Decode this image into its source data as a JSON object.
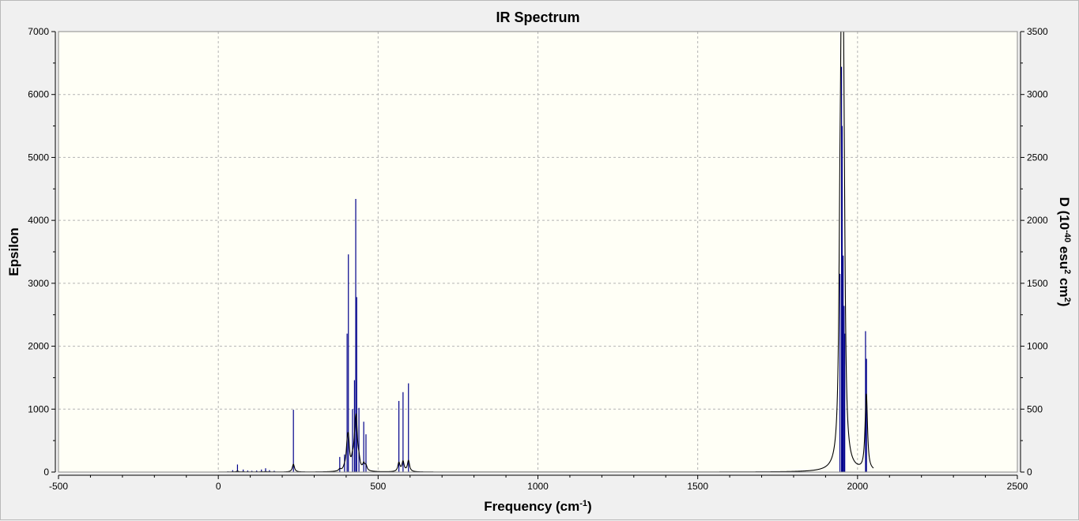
{
  "colors": {
    "plot_background": "#fffff6",
    "window_background": "#f0f0f0",
    "grid": "#b4b4b4",
    "stick_color": "#00008b",
    "curve_color": "#000000"
  },
  "chart_data": {
    "type": "line",
    "title": "IR Spectrum",
    "xlabel": {
      "text": "Frequency (cm",
      "superscript": "-1",
      "suffix": ")"
    },
    "ylabel_left": "Epsilon",
    "ylabel_right": {
      "parts": [
        {
          "text": "D (10"
        },
        {
          "text": "-40",
          "sup": true
        },
        {
          "text": " esu"
        },
        {
          "text": "2",
          "sup": true
        },
        {
          "text": " cm"
        },
        {
          "text": "2",
          "sup": true
        },
        {
          "text": ")"
        }
      ]
    },
    "xlim": [
      -500,
      2500
    ],
    "ylim_left": [
      0,
      7000
    ],
    "ylim_right": [
      0,
      3500
    ],
    "x_ticks": [
      "-500",
      "0",
      "500",
      "1000",
      "1500",
      "2000",
      "2500"
    ],
    "y_ticks_left": [
      "0",
      "1000",
      "2000",
      "3000",
      "4000",
      "5000",
      "6000",
      "7000"
    ],
    "y_ticks_right": [
      "0",
      "500",
      "1000",
      "1500",
      "2000",
      "2500",
      "3000",
      "3500"
    ],
    "grid": true,
    "curve_range": [
      0,
      2050
    ],
    "series": [
      {
        "kind": "sticks",
        "axis": "right",
        "x": [
          30,
          45,
          60,
          78,
          92,
          105,
          120,
          135,
          148,
          160,
          175,
          235,
          380,
          395,
          403,
          407,
          420,
          426,
          430,
          433,
          440,
          455,
          462,
          565,
          578,
          595,
          1945,
          1950,
          1952,
          1955,
          1958,
          1960,
          2025,
          2028
        ],
        "y": [
          5,
          15,
          60,
          20,
          12,
          10,
          12,
          20,
          30,
          15,
          10,
          495,
          120,
          140,
          1100,
          1730,
          500,
          730,
          2170,
          1390,
          510,
          400,
          300,
          565,
          635,
          705,
          1575,
          3220,
          2750,
          1720,
          1320,
          1100,
          1120,
          900
        ]
      },
      {
        "kind": "envelope",
        "axis": "left",
        "x": [
          1945,
          1950,
          1952,
          1955,
          1958,
          2028
        ],
        "y": [
          4310,
          6320,
          6400,
          5460,
          3100,
          1850
        ]
      }
    ]
  }
}
